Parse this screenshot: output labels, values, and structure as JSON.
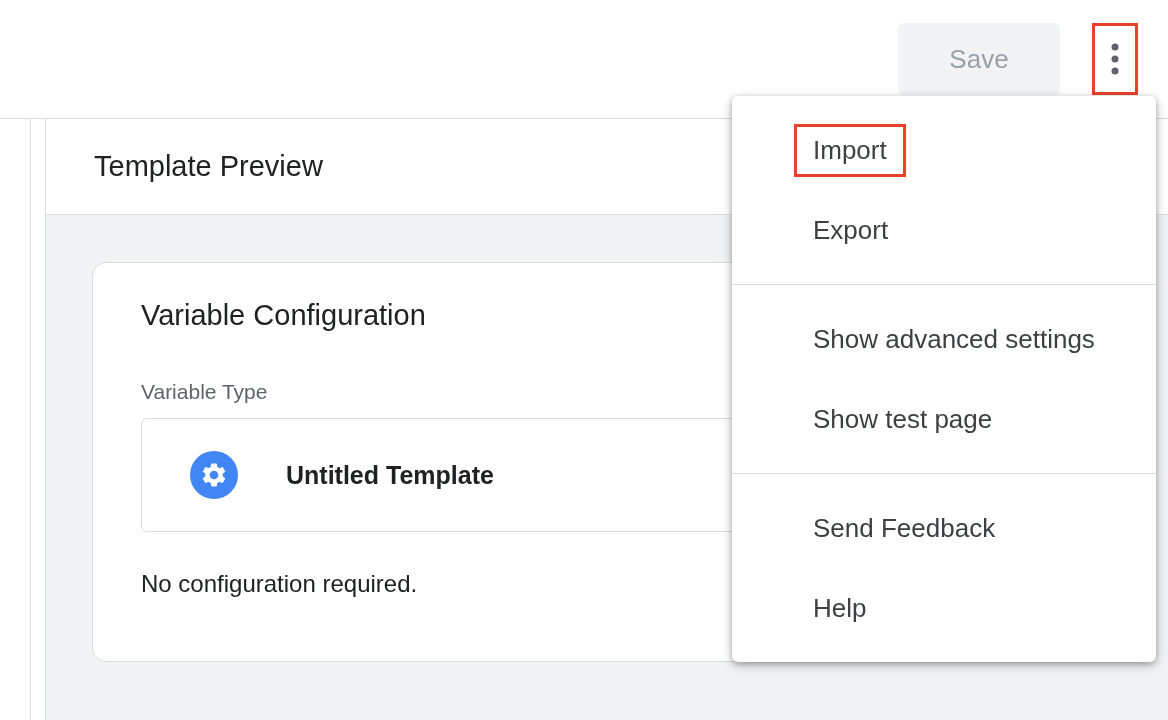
{
  "toolbar": {
    "save_button": {
      "label": "Save",
      "disabled": true
    },
    "more_button": {
      "highlighted": true
    }
  },
  "preview": {
    "title": "Template Preview",
    "card": {
      "title": "Variable Configuration",
      "type_label": "Variable Type",
      "type_name": "Untitled Template",
      "note": "No configuration required."
    }
  },
  "menu": {
    "groups": [
      [
        {
          "label": "Import",
          "highlighted": true
        },
        {
          "label": "Export",
          "highlighted": false
        }
      ],
      [
        {
          "label": "Show advanced settings",
          "highlighted": false
        },
        {
          "label": "Show test page",
          "highlighted": false
        }
      ],
      [
        {
          "label": "Send Feedback",
          "highlighted": false
        },
        {
          "label": "Help",
          "highlighted": false
        }
      ]
    ]
  }
}
